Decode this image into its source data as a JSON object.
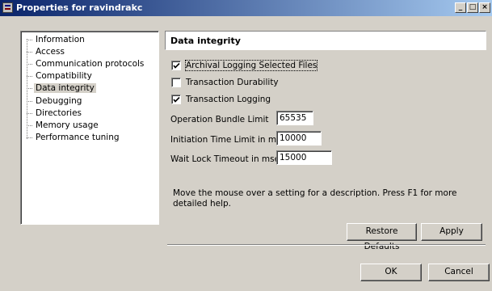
{
  "window": {
    "title": "Properties for ravindrakc",
    "controls": {
      "minimize": "_",
      "maximize": "□",
      "close": "×"
    }
  },
  "tree": {
    "items": [
      {
        "label": "Information"
      },
      {
        "label": "Access"
      },
      {
        "label": "Communication protocols"
      },
      {
        "label": "Compatibility"
      },
      {
        "label": "Data integrity",
        "selected": true
      },
      {
        "label": "Debugging"
      },
      {
        "label": "Directories"
      },
      {
        "label": "Memory usage"
      },
      {
        "label": "Performance tuning"
      }
    ]
  },
  "panel": {
    "title": "Data integrity",
    "checkboxes": [
      {
        "label": "Archival Logging Selected Files",
        "checked": true
      },
      {
        "label": "Transaction Durability",
        "checked": false
      },
      {
        "label": "Transaction Logging",
        "checked": true
      }
    ],
    "fields": [
      {
        "label": "Operation Bundle Limit",
        "value": "65535"
      },
      {
        "label": "Initiation Time Limit in msec",
        "value": "10000"
      },
      {
        "label": "Wait Lock Timeout in msec",
        "value": "15000"
      }
    ],
    "help": "Move the mouse over a setting for a description. Press F1 for more detailed help."
  },
  "buttons": {
    "restore_defaults": "Restore Defaults",
    "apply": "Apply",
    "ok": "OK",
    "cancel": "Cancel"
  }
}
